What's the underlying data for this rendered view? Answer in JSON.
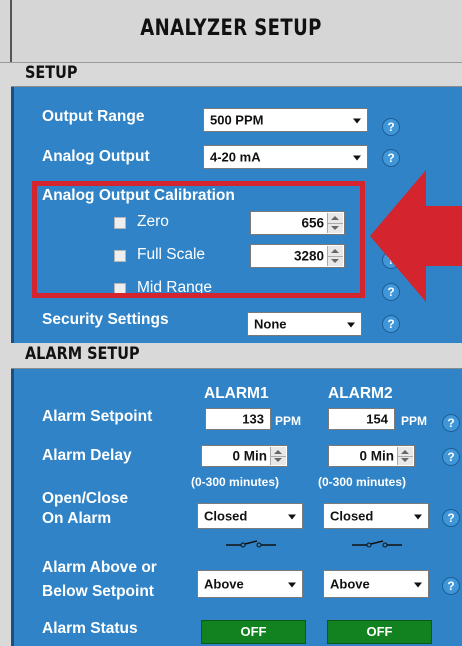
{
  "header": {
    "title": "ANALYZER SETUP"
  },
  "setup": {
    "heading": "SETUP",
    "output_range": {
      "label": "Output Range",
      "value": "500 PPM"
    },
    "analog_output": {
      "label": "Analog Output",
      "value": "4-20 mA"
    },
    "calibration": {
      "heading": "Analog Output Calibration",
      "zero": {
        "label": "Zero",
        "value": "656"
      },
      "full_scale": {
        "label": "Full Scale",
        "value": "3280"
      },
      "mid_range": {
        "label": "Mid Range"
      }
    },
    "security": {
      "label": "Security Settings",
      "value": "None"
    },
    "help_text": "?"
  },
  "alarm": {
    "heading": "ALARM SETUP",
    "col1": "ALARM1",
    "col2": "ALARM2",
    "setpoint": {
      "label": "Alarm Setpoint",
      "a1": "133",
      "a2": "154",
      "unit": "PPM"
    },
    "delay": {
      "label": "Alarm Delay",
      "a1": "0 Min",
      "a2": "0 Min",
      "hint": "(0-300 minutes)"
    },
    "open_close": {
      "label_line1": "Open/Close",
      "label_line2": "On Alarm",
      "a1": "Closed",
      "a2": "Closed"
    },
    "above_below": {
      "label_line1": "Alarm Above or",
      "label_line2": "Below Setpoint",
      "a1": "Above",
      "a2": "Above"
    },
    "status": {
      "label": "Alarm Status",
      "a1": "OFF",
      "a2": "OFF"
    }
  },
  "colors": {
    "panel": "#2f83c6",
    "callout": "#d4242e",
    "status_ok": "#11821f"
  },
  "icons": {
    "help": "help-icon",
    "arrow": "arrow-left-icon",
    "switch": "switch-symbol-icon"
  }
}
